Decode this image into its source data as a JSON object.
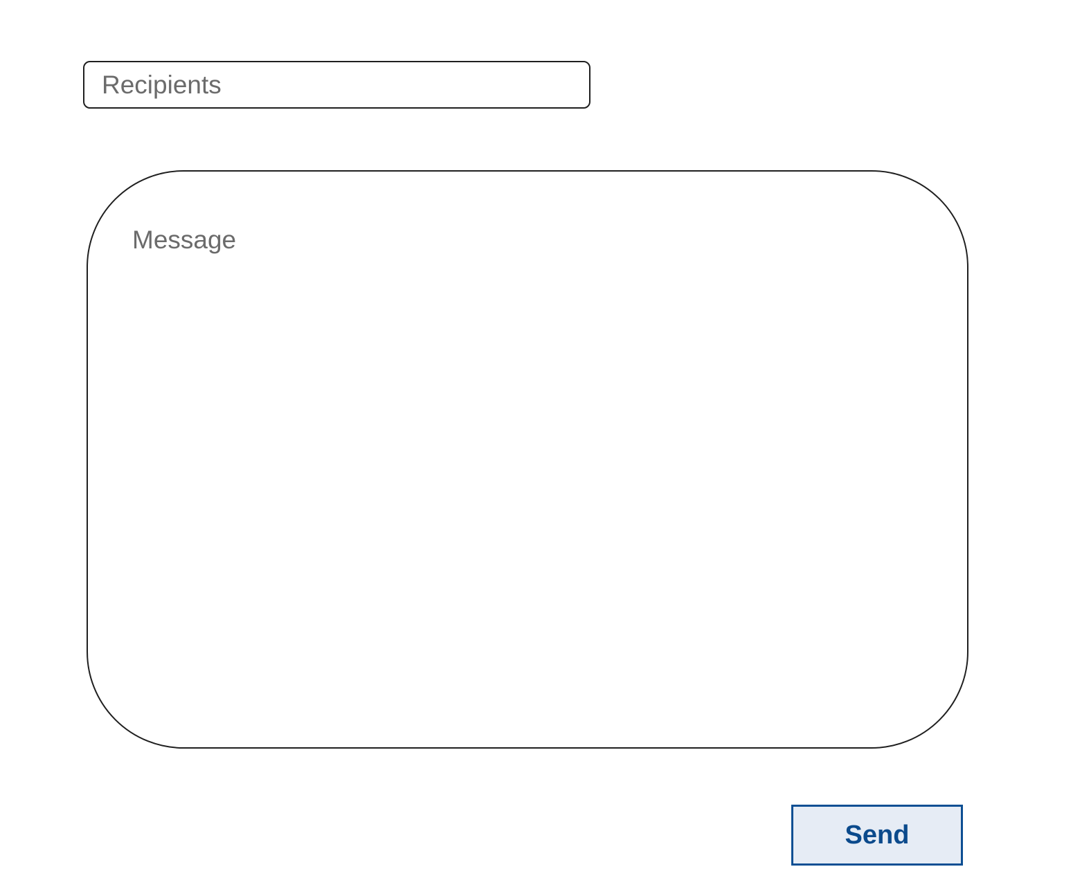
{
  "compose": {
    "recipients_placeholder": "Recipients",
    "message_placeholder": "Message",
    "send_label": "Send"
  },
  "colors": {
    "border": "#1f1f1f",
    "placeholder_text": "#6b6b6b",
    "send_button_border": "#0d4f93",
    "send_button_fill": "#e6ecf5",
    "send_button_text": "#0b4a8c"
  }
}
